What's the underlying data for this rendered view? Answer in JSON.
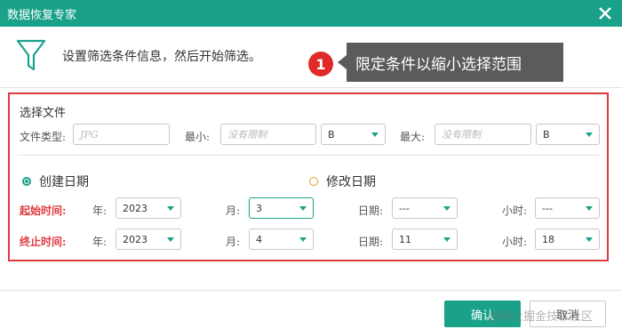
{
  "window": {
    "title": "数据恢复专家",
    "close_icon": "close-icon"
  },
  "header": {
    "instruction": "设置筛选条件信息，然后开始筛选。",
    "badge_number": "1",
    "callout_text": "限定条件以缩小选择范围"
  },
  "file_section": {
    "title": "选择文件",
    "file_type_label": "文件类型:",
    "file_type_placeholder": "JPG",
    "min_label": "最小:",
    "min_placeholder": "没有限制",
    "min_unit": "B",
    "max_label": "最大:",
    "max_placeholder": "没有限制",
    "max_unit": "B"
  },
  "date_section": {
    "created_label": "创建日期",
    "modified_label": "修改日期",
    "selected": "created",
    "start": {
      "label": "起始时间:",
      "year_label": "年:",
      "year": "2023",
      "month_label": "月:",
      "month": "3",
      "day_label": "日期:",
      "day": "---",
      "hour_label": "小时:",
      "hour": "---"
    },
    "end": {
      "label": "终止时间:",
      "year_label": "年:",
      "year": "2023",
      "month_label": "月:",
      "month": "4",
      "day_label": "日期:",
      "day": "11",
      "hour_label": "小时:",
      "hour": "18"
    }
  },
  "footer": {
    "ok_label": "确认",
    "cancel_label": "取消"
  },
  "watermark": "@稀土掘金技术社区",
  "colors": {
    "accent": "#1aa18a",
    "highlight": "#e0393e",
    "callout_bg": "#5b5b5b"
  }
}
